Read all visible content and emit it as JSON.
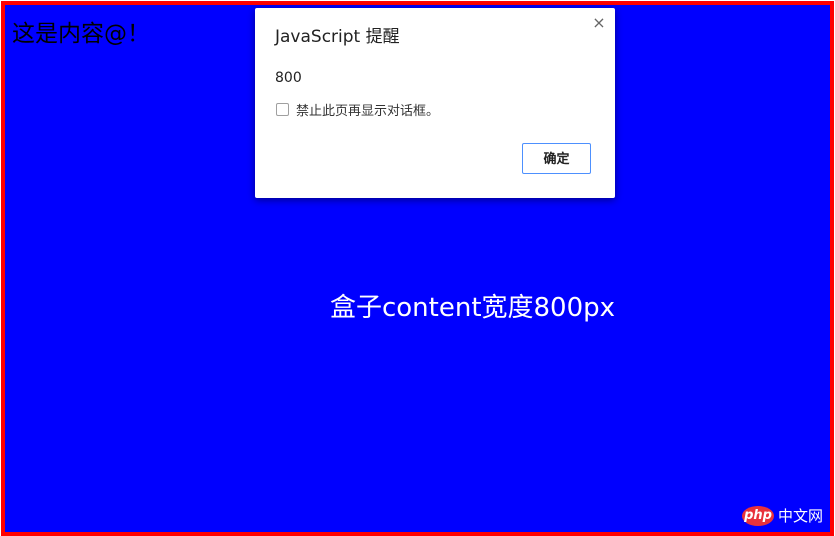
{
  "page": {
    "text": "这是内容@！",
    "box_caption": "盒子content宽度800px",
    "colors": {
      "box_background": "#0000ff",
      "box_border": "#ff0000"
    }
  },
  "dialog": {
    "title": "JavaScript 提醒",
    "close_glyph": "×",
    "message": "800",
    "checkbox_label": "禁止此页再显示对话框。",
    "checkbox_checked": false,
    "ok_label": "确定",
    "colors": {
      "ok_border": "#4d90fe"
    }
  },
  "watermark": {
    "logo_text": "php",
    "text": "中文网"
  }
}
